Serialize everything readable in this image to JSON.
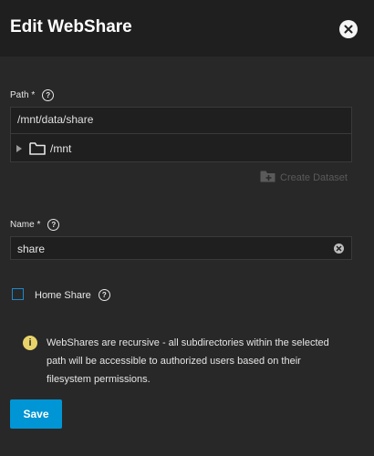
{
  "dialog": {
    "title": "Edit WebShare",
    "close_icon": "close-icon"
  },
  "path": {
    "label": "Path *",
    "value": "/mnt/data/share",
    "tree": [
      {
        "label": "/mnt",
        "icon": "folder-icon",
        "expanded": false
      }
    ],
    "create_dataset_label": "Create Dataset"
  },
  "name": {
    "label": "Name *",
    "value": "share"
  },
  "home_share": {
    "label": "Home Share",
    "checked": false
  },
  "info": {
    "text": "WebShares are recursive - all subdirectories within the selected path will be accessible to authorized users based on their filesystem permissions."
  },
  "actions": {
    "save_label": "Save"
  },
  "colors": {
    "accent": "#0095d5",
    "warning": "#e8d36a",
    "background": "#282828"
  }
}
